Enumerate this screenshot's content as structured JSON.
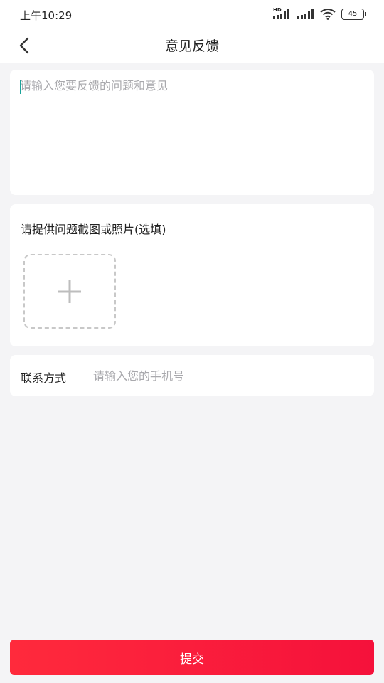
{
  "status_bar": {
    "time": "上午10:29",
    "network_label": "HD",
    "battery_level": "45"
  },
  "nav": {
    "title": "意见反馈"
  },
  "feedback": {
    "placeholder": "请输入您要反馈的问题和意见",
    "value": ""
  },
  "upload": {
    "label": "请提供问题截图或照片(选填)"
  },
  "contact": {
    "label": "联系方式",
    "placeholder": "请输入您的手机号",
    "value": ""
  },
  "submit": {
    "label": "提交"
  },
  "colors": {
    "accent": "#f5113b",
    "caret": "#1aa39a",
    "background": "#f4f4f6"
  },
  "icons": {
    "back": "chevron-left-icon",
    "add": "plus-icon",
    "signal": "signal-icon",
    "wifi": "wifi-icon",
    "battery": "battery-icon"
  }
}
